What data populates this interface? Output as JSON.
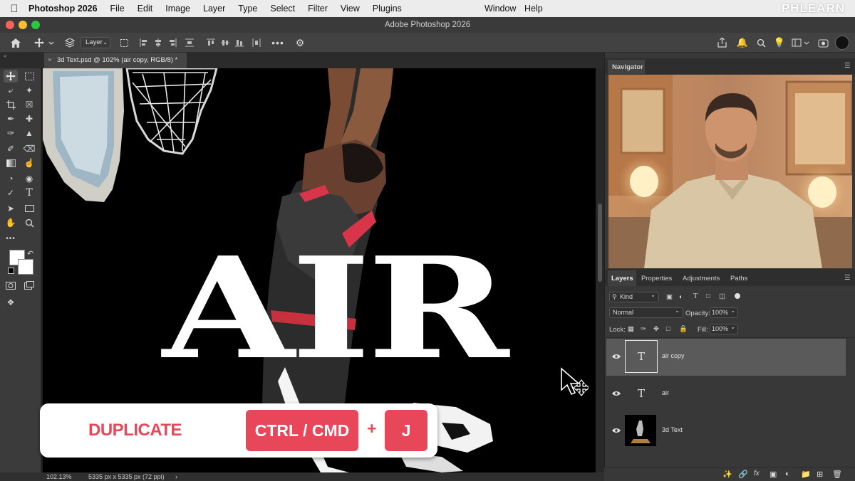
{
  "menubar": {
    "app_name": "Photoshop 2026",
    "items": [
      "File",
      "Edit",
      "Image",
      "Layer",
      "Type",
      "Select",
      "Filter",
      "View",
      "Plugins"
    ],
    "right_items": [
      "Window",
      "Help"
    ],
    "brand": "PHLEARN"
  },
  "window": {
    "title": "Adobe Photoshop 2026"
  },
  "options_bar": {
    "auto_select_target": "Layer"
  },
  "document": {
    "tab_title": "3d Text.psd @ 102% (air copy, RGB/8) *",
    "canvas_text": "AIR"
  },
  "statusbar": {
    "zoom": "102.13%",
    "doc_info": "5335 px x 5335 px (72 ppi)"
  },
  "navigator": {
    "title": "Navigator"
  },
  "layers_panel": {
    "tabs": [
      "Layers",
      "Properties",
      "Adjustments",
      "Paths"
    ],
    "filter_kind": "Kind",
    "blend_mode": "Normal",
    "opacity_label": "Opacity:",
    "opacity_value": "100%",
    "lock_label": "Lock:",
    "fill_label": "Fill:",
    "fill_value": "100%",
    "layers": [
      {
        "name": "air copy",
        "type": "text",
        "selected": true
      },
      {
        "name": "air",
        "type": "text",
        "selected": false
      },
      {
        "name": "3d Text",
        "type": "image",
        "selected": false
      }
    ]
  },
  "shortcut_overlay": {
    "action": "DUPLICATE",
    "key1": "CTRL / CMD",
    "plus": "+",
    "key2": "J"
  },
  "colors": {
    "overlay_accent": "#e8475a",
    "selected_layer_bg": "#5a5a5a",
    "panel_bg": "#383838",
    "canvas_bg": "#000000"
  }
}
